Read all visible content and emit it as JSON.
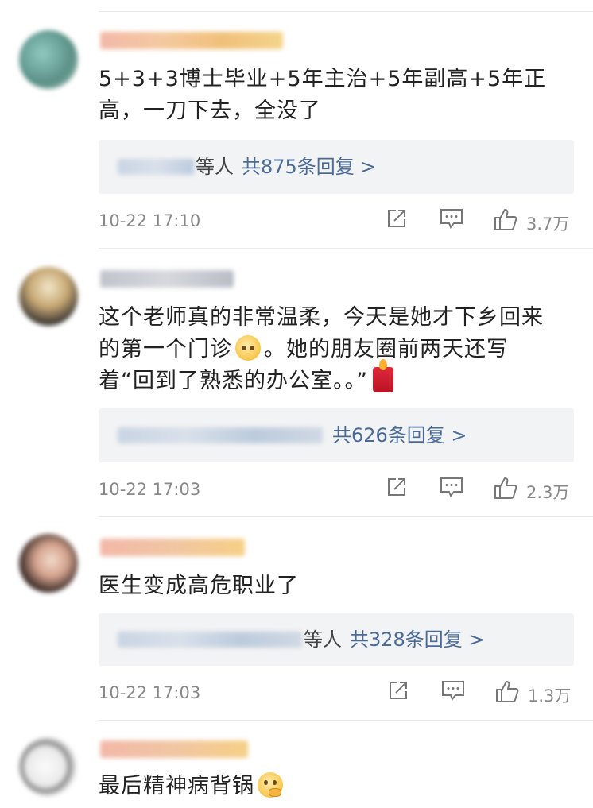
{
  "comments": [
    {
      "text": "5+3+3博士毕业+5年主治+5年副高+5年正高，一刀下去，全没了",
      "replies_others": "等人",
      "replies_count": "共875条回复 >",
      "time": "10-22 17:10",
      "likes": "3.7万"
    },
    {
      "text_a": "这个老师真的非常温柔，今天是她才下乡回来的第一个门诊",
      "text_b": "。她的朋友圈前两天还写着“回到了熟悉的办公室。。”",
      "replies_others": "",
      "replies_count": "共626条回复 >",
      "time": "10-22 17:03",
      "likes": "2.3万"
    },
    {
      "text": "医生变成高危职业了",
      "replies_others": "等人",
      "replies_count": "共328条回复 >",
      "time": "10-22 17:03",
      "likes": "1.3万"
    },
    {
      "text": "最后精神病背锅"
    }
  ],
  "icons": {
    "share": "share-icon",
    "comment": "comment-icon",
    "like": "thumbs-up-icon",
    "emoji_1": "pleading-face-icon",
    "emoji_2": "candle-icon",
    "emoji_3": "thinking-face-icon"
  },
  "colors": {
    "reply_count": "#4a6b96",
    "meta_text": "#888888",
    "reply_bg": "#f2f3f4"
  }
}
